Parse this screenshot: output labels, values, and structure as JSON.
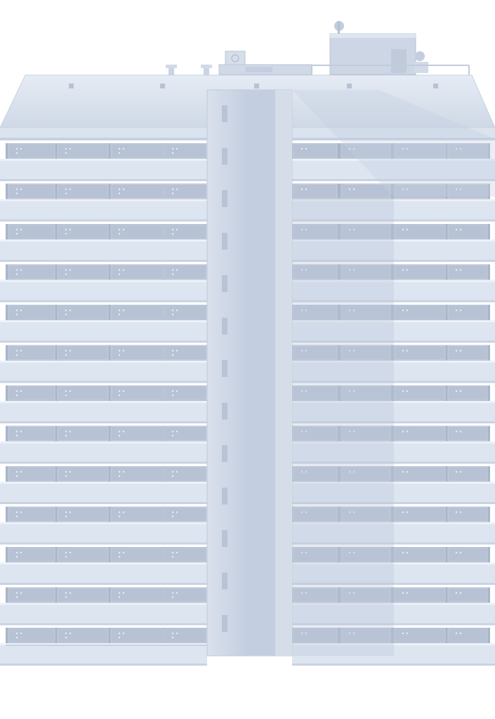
{
  "scene": {
    "subject": "high-rise-residential-tower",
    "view": "front-elevation",
    "floors": 13,
    "colors": {
      "sky": "#ffffff",
      "facade_light": "#dde5f1",
      "facade_mid": "#c9d3e3",
      "facade_shadow": "#bcc7d9",
      "window_glass": "#b7c3d4",
      "window_frame": "#a9b6c9",
      "roof": "#d4dcea",
      "core": "#c6d1e2",
      "core_light": "#d8e0ec"
    }
  }
}
